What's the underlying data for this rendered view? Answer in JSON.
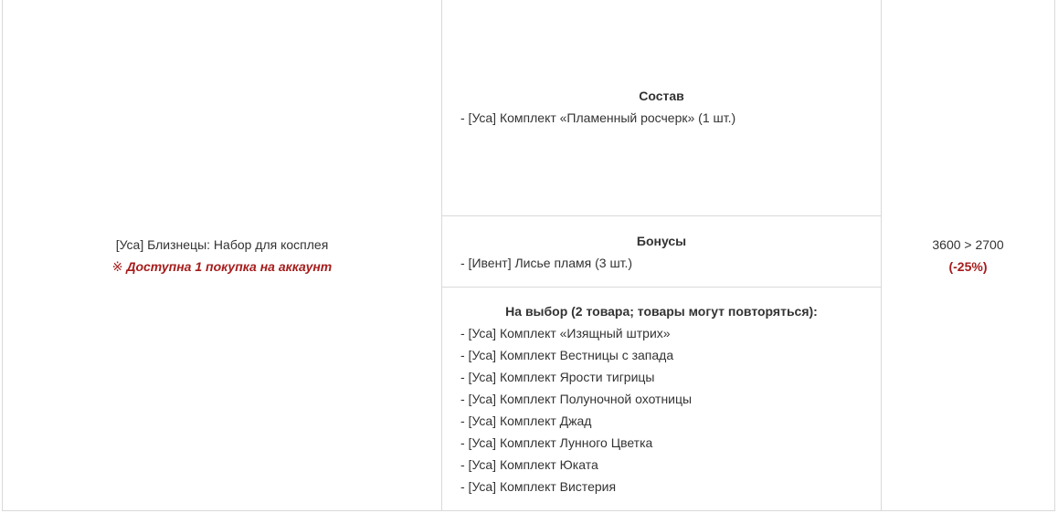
{
  "product": {
    "name": "[Уса] Близнецы: Набор для косплея",
    "limit_mark": "※",
    "limit_text": "Доступна 1 покупка на аккаунт"
  },
  "contents": {
    "composition": {
      "title": "Состав",
      "items": [
        "- [Уса] Комплект «Пламенный росчерк» (1 шт.)"
      ]
    },
    "bonuses": {
      "title": "Бонусы",
      "items": [
        "- [Ивент] Лисье пламя (3 шт.)"
      ]
    },
    "choice": {
      "title": "На выбор (2 товара; товары могут повторяться):",
      "items": [
        "- [Уса] Комплект «Изящный штрих»",
        "- [Уса] Комплект Вестницы с запада",
        "- [Уса] Комплект Ярости тигрицы",
        "- [Уса] Комплект Полуночной охотницы",
        "- [Уса] Комплект Джад",
        "- [Уса] Комплект Лунного Цветка",
        "- [Уса] Комплект Юката",
        "- [Уса] Комплект Вистерия"
      ]
    }
  },
  "price": {
    "text": "3600 > 2700",
    "discount": "(-25%)"
  },
  "colors": {
    "accent_red": "#a61c1c",
    "text": "#333333",
    "border": "#d9d9d9"
  }
}
